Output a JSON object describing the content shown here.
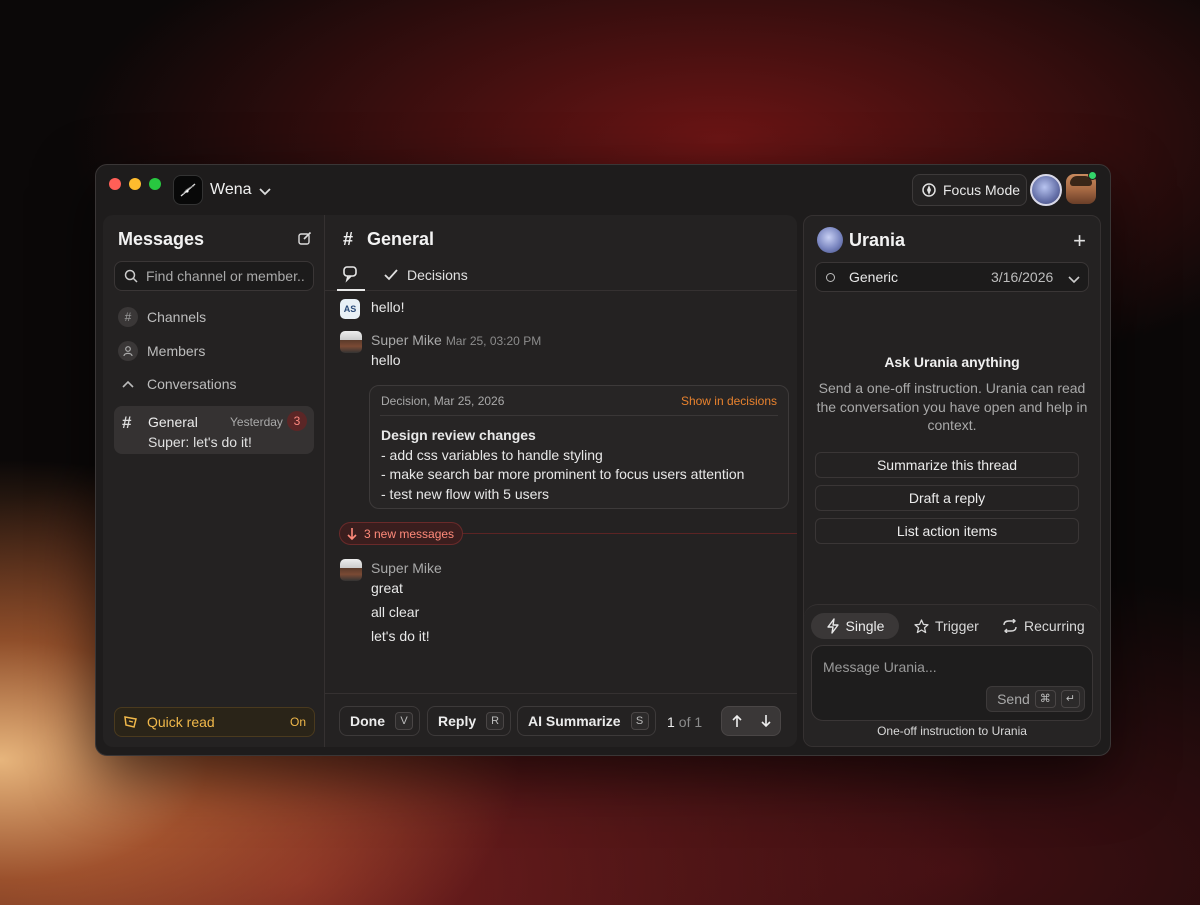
{
  "app": {
    "name": "Wena",
    "focus_mode_label": "Focus Mode"
  },
  "sidebar": {
    "title": "Messages",
    "search_placeholder": "Find channel or member..",
    "nav": [
      {
        "label": "Channels",
        "icon": "hash-icon"
      },
      {
        "label": "Members",
        "icon": "person-icon"
      },
      {
        "label": "Conversations",
        "icon": "chevron-up-icon"
      }
    ],
    "conversation": {
      "name": "General",
      "time": "Yesterday",
      "unread": "3",
      "preview": "Super: let's do it!"
    },
    "quick_read": {
      "label": "Quick read",
      "state": "On"
    }
  },
  "channel": {
    "name": "General",
    "tab_decisions": "Decisions",
    "messages": [
      {
        "avatar": "AS",
        "text": "hello!"
      },
      {
        "author": "Super Mike",
        "time": "Mar 25, 03:20 PM",
        "text": "hello"
      }
    ],
    "decision": {
      "header": "Decision, Mar 25, 2026",
      "link": "Show in decisions",
      "title": "Design review changes",
      "items": [
        "- add css variables to handle styling",
        "- make search bar more prominent to focus users attention",
        "- test new flow with 5 users"
      ]
    },
    "new_messages_label": "3 new messages",
    "later": {
      "author": "Super Mike",
      "lines": [
        "great",
        "all clear",
        "let's do it!"
      ]
    },
    "footer": {
      "done": {
        "label": "Done",
        "key": "V"
      },
      "reply": {
        "label": "Reply",
        "key": "R"
      },
      "summarize": {
        "label": "AI Summarize",
        "key": "S"
      },
      "page_current": "1",
      "page_total": "of 1"
    }
  },
  "assistant": {
    "name": "Urania",
    "context": {
      "name": "Generic",
      "date": "3/16/2026"
    },
    "heading": "Ask Urania anything",
    "description": "Send a one-off instruction. Urania can read the conversation you have open and help in context.",
    "actions": [
      "Summarize this thread",
      "Draft a reply",
      "List action items"
    ],
    "modes": [
      "Single",
      "Trigger",
      "Recurring"
    ],
    "composer_placeholder": "Message Urania...",
    "send_label": "Send",
    "send_keys": [
      "⌘",
      "↵"
    ],
    "hint": "One-off instruction to Urania"
  },
  "colors": {
    "accent_orange": "#e8822e",
    "unread_red": "#ff8a80",
    "quick_read_amber": "#f0b84a",
    "online_green": "#33d46a"
  }
}
